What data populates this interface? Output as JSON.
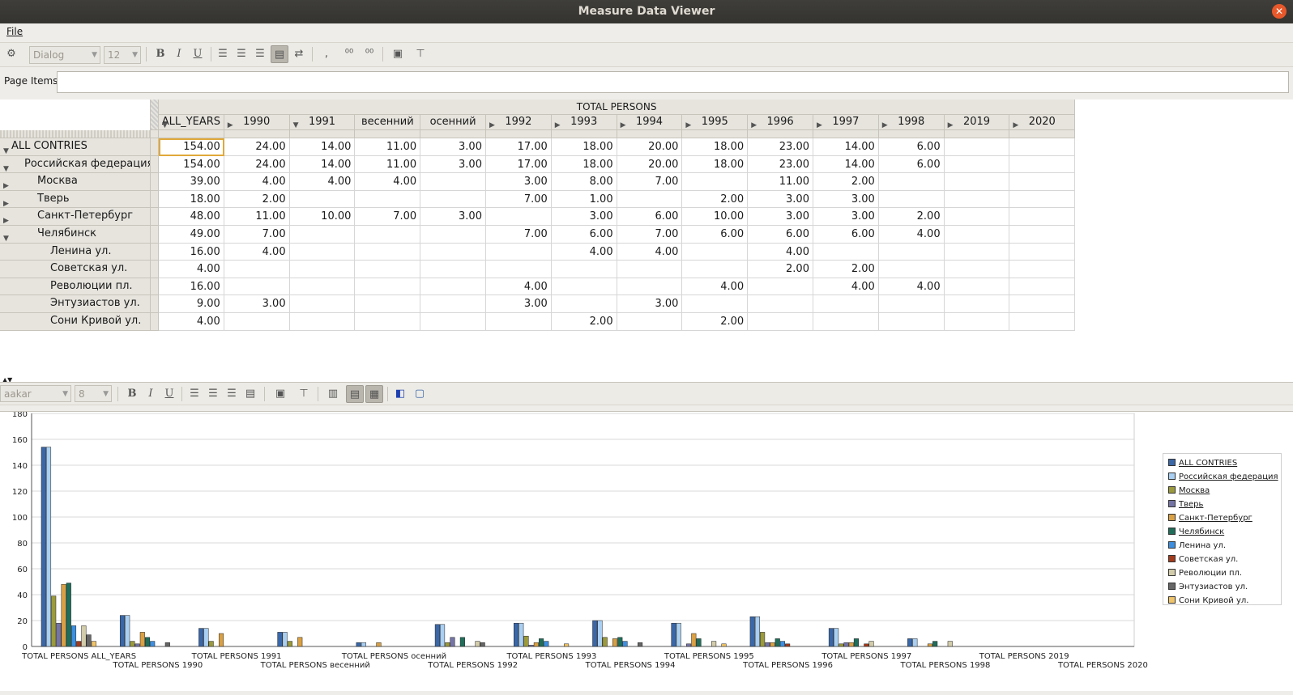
{
  "window": {
    "title": "Measure Data Viewer"
  },
  "menu": {
    "file": "File"
  },
  "toolbar": {
    "font_name": "Dialog",
    "font_size": "12",
    "bold": "B",
    "italic": "I",
    "underline": "U"
  },
  "page_items": {
    "label": "Page Items"
  },
  "grid": {
    "measure_header": "TOTAL PERSONS",
    "columns": [
      "ALL_YEARS",
      "1990",
      "1991",
      "весенний",
      "осенний",
      "1992",
      "1993",
      "1994",
      "1995",
      "1996",
      "1997",
      "1998",
      "2019",
      "2020"
    ],
    "rows": [
      {
        "label": "ALL CONTRIES",
        "values": [
          "154.00",
          "24.00",
          "14.00",
          "11.00",
          "3.00",
          "17.00",
          "18.00",
          "20.00",
          "18.00",
          "23.00",
          "14.00",
          "6.00",
          "",
          ""
        ]
      },
      {
        "label": "Российская федерация",
        "values": [
          "154.00",
          "24.00",
          "14.00",
          "11.00",
          "3.00",
          "17.00",
          "18.00",
          "20.00",
          "18.00",
          "23.00",
          "14.00",
          "6.00",
          "",
          ""
        ]
      },
      {
        "label": "Москва",
        "values": [
          "39.00",
          "4.00",
          "4.00",
          "4.00",
          "",
          "3.00",
          "8.00",
          "7.00",
          "",
          "11.00",
          "2.00",
          "",
          "",
          ""
        ]
      },
      {
        "label": "Тверь",
        "values": [
          "18.00",
          "2.00",
          "",
          "",
          "",
          "7.00",
          "1.00",
          "",
          "2.00",
          "3.00",
          "3.00",
          "",
          "",
          ""
        ]
      },
      {
        "label": "Санкт-Петербург",
        "values": [
          "48.00",
          "11.00",
          "10.00",
          "7.00",
          "3.00",
          "",
          "3.00",
          "6.00",
          "10.00",
          "3.00",
          "3.00",
          "2.00",
          "",
          ""
        ]
      },
      {
        "label": "Челябинск",
        "values": [
          "49.00",
          "7.00",
          "",
          "",
          "",
          "7.00",
          "6.00",
          "7.00",
          "6.00",
          "6.00",
          "6.00",
          "4.00",
          "",
          ""
        ]
      },
      {
        "label": "Ленина ул.",
        "values": [
          "16.00",
          "4.00",
          "",
          "",
          "",
          "",
          "4.00",
          "4.00",
          "",
          "4.00",
          "",
          "",
          "",
          ""
        ]
      },
      {
        "label": "Советская ул.",
        "values": [
          "4.00",
          "",
          "",
          "",
          "",
          "",
          "",
          "",
          "",
          "2.00",
          "2.00",
          "",
          "",
          ""
        ]
      },
      {
        "label": "Революции пл.",
        "values": [
          "16.00",
          "",
          "",
          "",
          "",
          "4.00",
          "",
          "",
          "4.00",
          "",
          "4.00",
          "4.00",
          "",
          ""
        ]
      },
      {
        "label": "Энтузиастов ул.",
        "values": [
          "9.00",
          "3.00",
          "",
          "",
          "",
          "3.00",
          "",
          "3.00",
          "",
          "",
          "",
          "",
          "",
          ""
        ]
      },
      {
        "label": "Сони Кривой ул.",
        "values": [
          "4.00",
          "",
          "",
          "",
          "",
          "",
          "2.00",
          "",
          "2.00",
          "",
          "",
          "",
          "",
          ""
        ]
      }
    ]
  },
  "chart_toolbar": {
    "font_name": "aakar",
    "font_size": "8",
    "bold": "B",
    "italic": "I",
    "underline": "U"
  },
  "chart_data": {
    "type": "bar",
    "categories": [
      "TOTAL PERSONS ALL_YEARS",
      "TOTAL PERSONS 1990",
      "TOTAL PERSONS 1991",
      "TOTAL PERSONS весенний",
      "TOTAL PERSONS осенний",
      "TOTAL PERSONS 1992",
      "TOTAL PERSONS 1993",
      "TOTAL PERSONS 1994",
      "TOTAL PERSONS 1995",
      "TOTAL PERSONS 1996",
      "TOTAL PERSONS 1997",
      "TOTAL PERSONS 1998",
      "TOTAL PERSONS 2019",
      "TOTAL PERSONS 2020"
    ],
    "ylim": [
      0,
      180
    ],
    "yticks": [
      0,
      20,
      40,
      60,
      80,
      100,
      120,
      140,
      160,
      180
    ],
    "grid": true,
    "legend": "right",
    "series": [
      {
        "name": "ALL CONTRIES",
        "color": "#3a67a8",
        "values": [
          154,
          24,
          14,
          11,
          3,
          17,
          18,
          20,
          18,
          23,
          14,
          6,
          0,
          0
        ]
      },
      {
        "name": "Российская федерация",
        "color": "#a9cff2",
        "values": [
          154,
          24,
          14,
          11,
          3,
          17,
          18,
          20,
          18,
          23,
          14,
          6,
          0,
          0
        ]
      },
      {
        "name": "Москва",
        "color": "#9b9a3c",
        "values": [
          39,
          4,
          4,
          4,
          0,
          3,
          8,
          7,
          0,
          11,
          2,
          0,
          0,
          0
        ]
      },
      {
        "name": "Тверь",
        "color": "#7474a6",
        "values": [
          18,
          2,
          0,
          0,
          0,
          7,
          1,
          0,
          2,
          3,
          3,
          0,
          0,
          0
        ]
      },
      {
        "name": "Санкт-Петербург",
        "color": "#d9a044",
        "values": [
          48,
          11,
          10,
          7,
          3,
          0,
          3,
          6,
          10,
          3,
          3,
          2,
          0,
          0
        ]
      },
      {
        "name": "Челябинск",
        "color": "#1f6e5a",
        "values": [
          49,
          7,
          0,
          0,
          0,
          7,
          6,
          7,
          6,
          6,
          6,
          4,
          0,
          0
        ]
      },
      {
        "name": "Ленина ул.",
        "color": "#3c8fe0",
        "values": [
          16,
          4,
          0,
          0,
          0,
          0,
          4,
          4,
          0,
          4,
          0,
          0,
          0,
          0
        ]
      },
      {
        "name": "Советская ул.",
        "color": "#a33a1c",
        "values": [
          4,
          0,
          0,
          0,
          0,
          0,
          0,
          0,
          0,
          2,
          2,
          0,
          0,
          0
        ]
      },
      {
        "name": "Революции пл.",
        "color": "#d2ccaa",
        "values": [
          16,
          0,
          0,
          0,
          0,
          4,
          0,
          0,
          4,
          0,
          4,
          4,
          0,
          0
        ]
      },
      {
        "name": "Энтузиастов ул.",
        "color": "#666666",
        "values": [
          9,
          3,
          0,
          0,
          0,
          3,
          0,
          3,
          0,
          0,
          0,
          0,
          0,
          0
        ]
      },
      {
        "name": "Сони Кривой ул.",
        "color": "#f0c46a",
        "values": [
          4,
          0,
          0,
          0,
          0,
          0,
          2,
          0,
          2,
          0,
          0,
          0,
          0,
          0
        ]
      }
    ]
  }
}
